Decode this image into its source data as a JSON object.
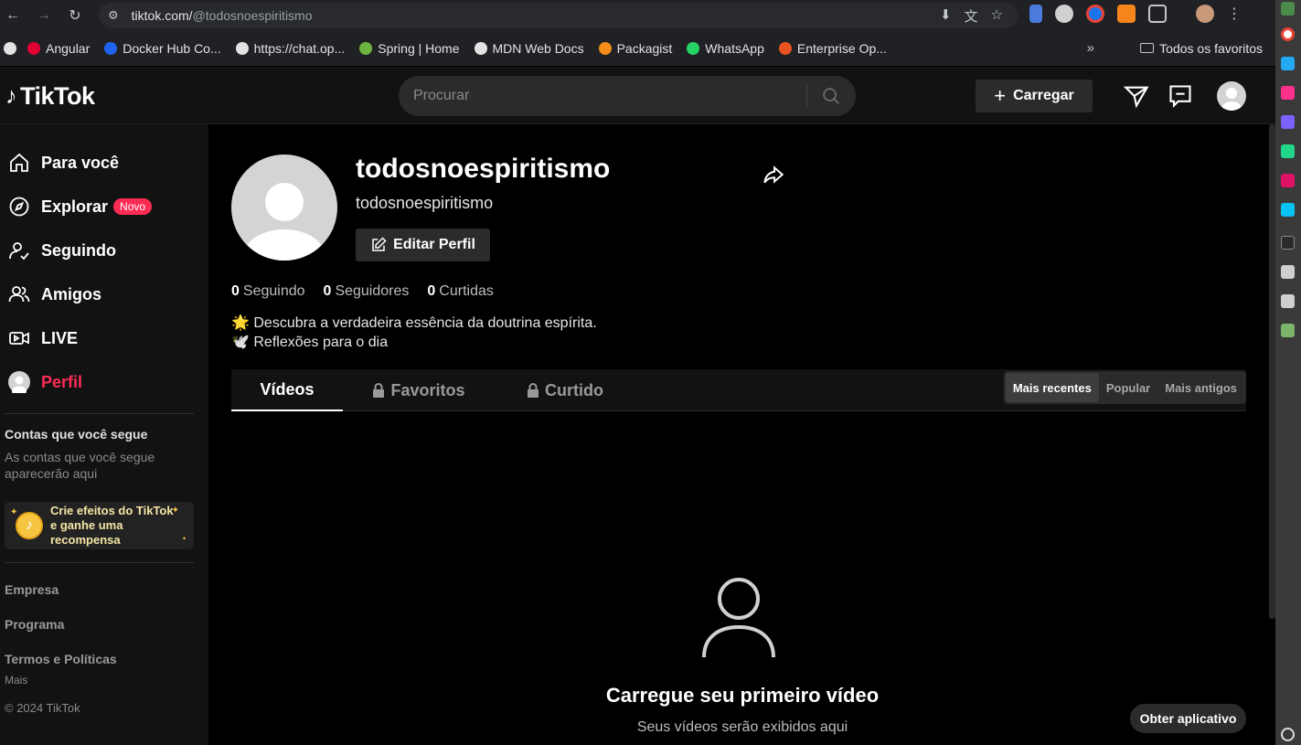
{
  "browser": {
    "url_host": "tiktok.com/",
    "url_path": "@todosnoespiritismo",
    "bookmarks": [
      {
        "label": "Angular",
        "color": "#dd0031"
      },
      {
        "label": "Docker Hub Co...",
        "color": "#1d63ed"
      },
      {
        "label": "https://chat.op...",
        "color": "#e3e3e3"
      },
      {
        "label": "Spring | Home",
        "color": "#6db33f"
      },
      {
        "label": "MDN Web Docs",
        "color": "#e3e3e3"
      },
      {
        "label": "Packagist",
        "color": "#f28d1a"
      },
      {
        "label": "WhatsApp",
        "color": "#25d366"
      },
      {
        "label": "Enterprise Op...",
        "color": "#e95420"
      }
    ],
    "all_bookmarks": "Todos os favoritos",
    "overflow": "»"
  },
  "header": {
    "logo": "TikTok",
    "search_placeholder": "Procurar",
    "upload_label": "Carregar"
  },
  "sidebar": {
    "items": [
      {
        "label": "Para você",
        "icon": "home-icon"
      },
      {
        "label": "Explorar",
        "icon": "compass-icon",
        "badge": "Novo"
      },
      {
        "label": "Seguindo",
        "icon": "following-icon"
      },
      {
        "label": "Amigos",
        "icon": "friends-icon"
      },
      {
        "label": "LIVE",
        "icon": "live-icon"
      },
      {
        "label": "Perfil",
        "icon": "avatar",
        "active": true
      }
    ],
    "following_title": "Contas que você segue",
    "following_desc": "As contas que você segue aparecerão aqui",
    "effects_text": "Crie efeitos do TikTok e ganhe uma recompensa",
    "links": [
      "Empresa",
      "Programa",
      "Termos e Políticas"
    ],
    "more": "Mais",
    "copyright": "© 2024 TikTok"
  },
  "profile": {
    "username": "todosnoespiritismo",
    "display_name": "todosnoespiritismo",
    "edit_label": "Editar Perfil",
    "stats": [
      {
        "count": "0",
        "label": "Seguindo"
      },
      {
        "count": "0",
        "label": "Seguidores"
      },
      {
        "count": "0",
        "label": "Curtidas"
      }
    ],
    "bio_line1": "🌟 Descubra a verdadeira essência da doutrina espírita.",
    "bio_line2": "🕊️ Reflexões para o dia"
  },
  "tabs": {
    "videos": "Vídeos",
    "favorites": "Favoritos",
    "liked": "Curtido"
  },
  "sort": {
    "recent": "Mais recentes",
    "popular": "Popular",
    "oldest": "Mais antigos"
  },
  "empty_state": {
    "title": "Carregue seu primeiro vídeo",
    "subtitle": "Seus vídeos serão exibidos aqui"
  },
  "get_app": "Obter aplicativo",
  "colors": {
    "accent": "#fe2c55",
    "background": "#000000",
    "surface": "#121212"
  }
}
